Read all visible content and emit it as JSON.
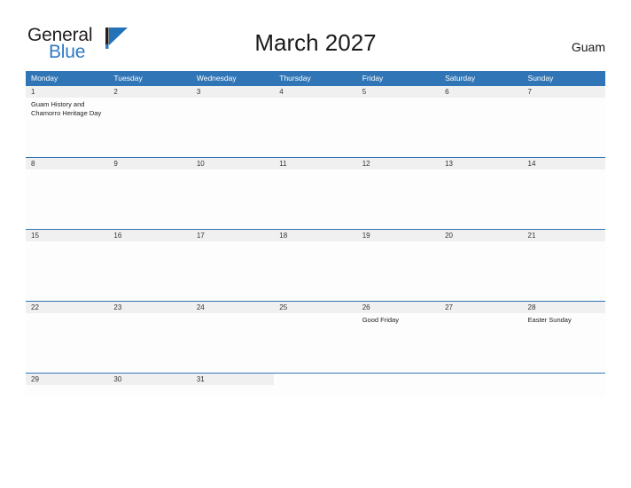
{
  "brand": {
    "name_part1": "General",
    "name_part2": "Blue",
    "flag_icon": "flag-icon",
    "color_dark": "#231f20",
    "color_blue": "#2e7ac4"
  },
  "header": {
    "title": "March 2027",
    "country": "Guam"
  },
  "theme": {
    "header_blue": "#3075b5",
    "date_band_gray": "#f0f0f0",
    "page_background": "#ffffff"
  },
  "calendar": {
    "weekdays": [
      "Monday",
      "Tuesday",
      "Wednesday",
      "Thursday",
      "Friday",
      "Saturday",
      "Sunday"
    ],
    "weeks": [
      {
        "height": "tall",
        "days": [
          {
            "date": "1",
            "events": [
              "Guam History and Chamorro Heritage Day"
            ]
          },
          {
            "date": "2",
            "events": []
          },
          {
            "date": "3",
            "events": []
          },
          {
            "date": "4",
            "events": []
          },
          {
            "date": "5",
            "events": []
          },
          {
            "date": "6",
            "events": []
          },
          {
            "date": "7",
            "events": []
          }
        ]
      },
      {
        "height": "tall",
        "days": [
          {
            "date": "8",
            "events": []
          },
          {
            "date": "9",
            "events": []
          },
          {
            "date": "10",
            "events": []
          },
          {
            "date": "11",
            "events": []
          },
          {
            "date": "12",
            "events": []
          },
          {
            "date": "13",
            "events": []
          },
          {
            "date": "14",
            "events": []
          }
        ]
      },
      {
        "height": "tall",
        "days": [
          {
            "date": "15",
            "events": []
          },
          {
            "date": "16",
            "events": []
          },
          {
            "date": "17",
            "events": []
          },
          {
            "date": "18",
            "events": []
          },
          {
            "date": "19",
            "events": []
          },
          {
            "date": "20",
            "events": []
          },
          {
            "date": "21",
            "events": []
          }
        ]
      },
      {
        "height": "tall",
        "days": [
          {
            "date": "22",
            "events": []
          },
          {
            "date": "23",
            "events": []
          },
          {
            "date": "24",
            "events": []
          },
          {
            "date": "25",
            "events": []
          },
          {
            "date": "26",
            "events": [
              "Good Friday"
            ]
          },
          {
            "date": "27",
            "events": []
          },
          {
            "date": "28",
            "events": [
              "Easter Sunday"
            ]
          }
        ]
      },
      {
        "height": "short",
        "days": [
          {
            "date": "29",
            "events": []
          },
          {
            "date": "30",
            "events": []
          },
          {
            "date": "31",
            "events": []
          },
          {
            "date": "",
            "events": []
          },
          {
            "date": "",
            "events": []
          },
          {
            "date": "",
            "events": []
          },
          {
            "date": "",
            "events": []
          }
        ]
      }
    ]
  }
}
